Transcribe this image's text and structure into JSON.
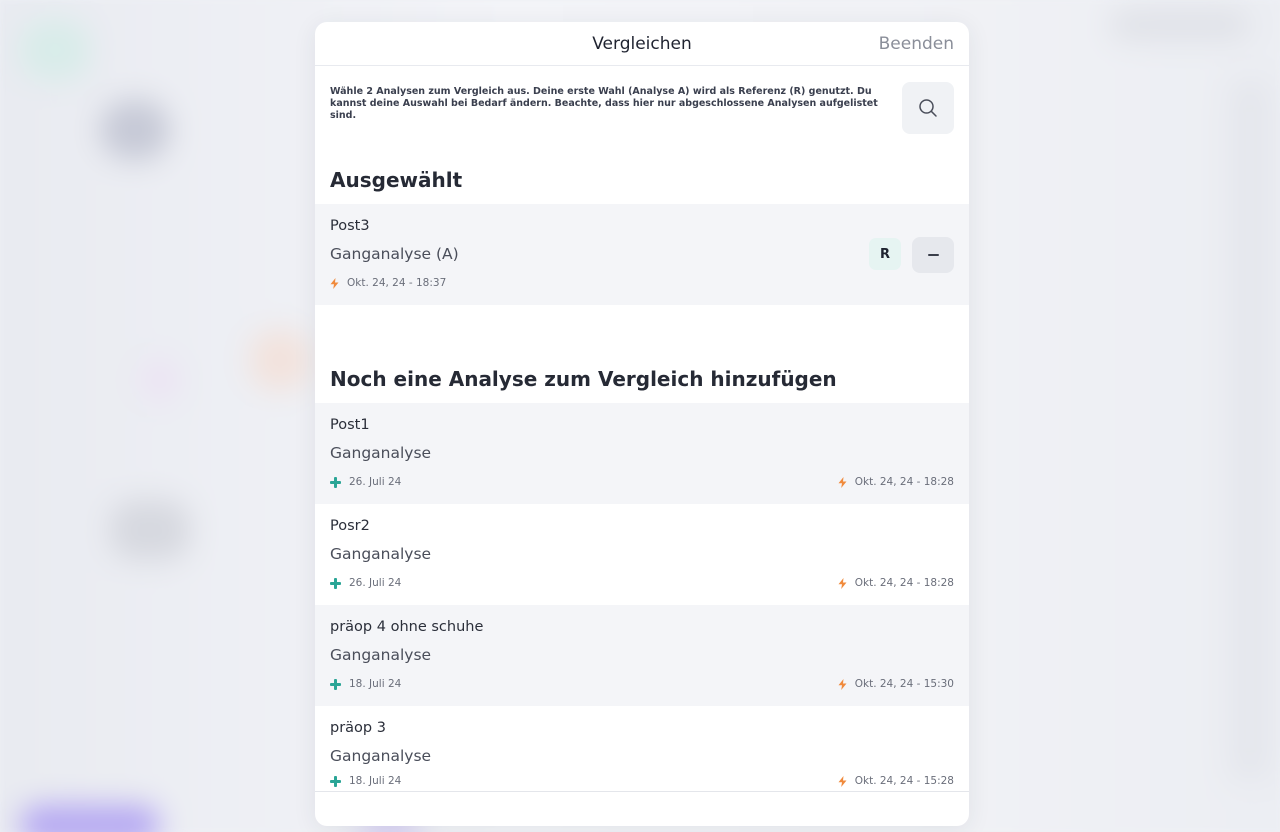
{
  "header": {
    "title": "Vergleichen",
    "done_label": "Beenden"
  },
  "intro": {
    "text": "Wähle 2 Analysen zum Vergleich aus. Deine erste Wahl (Analyse A) wird als Referenz (R) genutzt. Du kannst deine Auswahl bei Bedarf ändern. Beachte, dass hier nur abgeschlossene Analysen aufgelistet sind."
  },
  "selected": {
    "title": "Ausgewählt",
    "item": {
      "name": "Post3",
      "type": "Ganganalyse (A)",
      "date": "Okt. 24, 24 - 18:37",
      "ref_label": "R"
    }
  },
  "available": {
    "title": "Noch eine Analyse zum Vergleich hinzufügen",
    "items": [
      {
        "name": "Post1",
        "type": "Ganganalyse",
        "created": "26. Juli 24",
        "analyzed": "Okt. 24, 24 - 18:28"
      },
      {
        "name": "Posr2",
        "type": "Ganganalyse",
        "created": "26. Juli 24",
        "analyzed": "Okt. 24, 24 - 18:28"
      },
      {
        "name": "präop 4 ohne schuhe",
        "type": "Ganganalyse",
        "created": "18. Juli 24",
        "analyzed": "Okt. 24, 24 - 15:30"
      },
      {
        "name": "präop 3",
        "type": "Ganganalyse",
        "created": "18. Juli 24",
        "analyzed": "Okt. 24, 24 - 15:28"
      }
    ]
  },
  "icons": {
    "search": "search-icon",
    "bolt": "bolt-icon",
    "plus": "plus-icon",
    "minus": "minus-icon"
  },
  "colors": {
    "bolt": "#f08a3c",
    "plus": "#2aa596",
    "ref_badge_bg": "#e6f4f2"
  }
}
